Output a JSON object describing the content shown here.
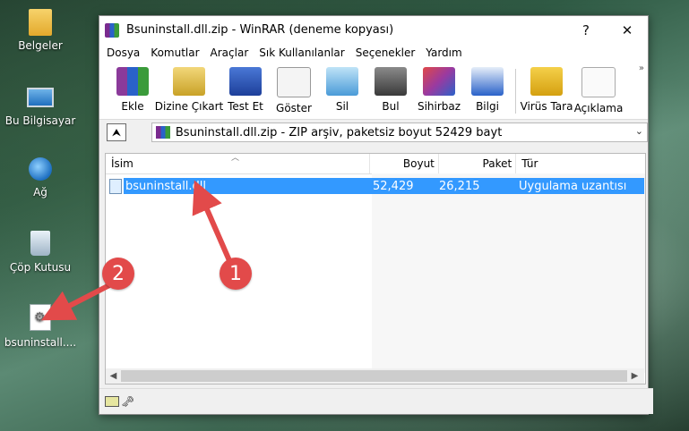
{
  "desktop": {
    "icons": [
      {
        "label": "Belgeler",
        "icon": "folder-icon"
      },
      {
        "label": "Bu Bilgisayar",
        "icon": "computer-icon"
      },
      {
        "label": "Ağ",
        "icon": "network-icon"
      },
      {
        "label": "Çöp Kutusu",
        "icon": "recycle-bin-icon"
      },
      {
        "label": "bsuninstall....",
        "icon": "dll-file-icon"
      }
    ]
  },
  "window": {
    "title": "Bsuninstall.dll.zip - WinRAR (deneme kopyası)",
    "help_glyph": "?",
    "close_glyph": "✕",
    "menu": [
      "Dosya",
      "Komutlar",
      "Araçlar",
      "Sık Kullanılanlar",
      "Seçenekler",
      "Yardım"
    ],
    "toolbar": [
      {
        "label": "Ekle",
        "color": "#8b3a9a"
      },
      {
        "label": "Dizine Çıkart",
        "color": "#c9a227"
      },
      {
        "label": "Test Et",
        "color": "#2a4fb0"
      },
      {
        "label": "Göster",
        "color": "#d9d9d9"
      },
      {
        "label": "Sil",
        "color": "#4a9bd8"
      },
      {
        "label": "Bul",
        "color": "#5a5a5a"
      },
      {
        "label": "Sihirbaz",
        "color": "#9a3aa0"
      },
      {
        "label": "Bilgi",
        "color": "#2a62c9"
      },
      {
        "label": "Virüs Tara",
        "color": "#d4a010"
      },
      {
        "label": "Açıklama",
        "color": "#e5e5e5"
      }
    ],
    "toolbar_more": "»",
    "address": {
      "up_glyph": "⮝",
      "text": "Bsuninstall.dll.zip - ZIP arşiv, paketsiz boyut 52429 bayt",
      "drop_glyph": "⌄"
    },
    "columns": {
      "name": "İsim",
      "size": "Boyut",
      "packed": "Paket",
      "type": "Tür"
    },
    "files": [
      {
        "name": "bsuninstall.dll",
        "size": "52,429",
        "packed": "26,215",
        "type": "Uygulama uzantısı"
      }
    ],
    "selection_color": "#3399ff"
  },
  "annotations": [
    {
      "number": "1",
      "color": "#e24a4a"
    },
    {
      "number": "2",
      "color": "#e24a4a"
    }
  ]
}
